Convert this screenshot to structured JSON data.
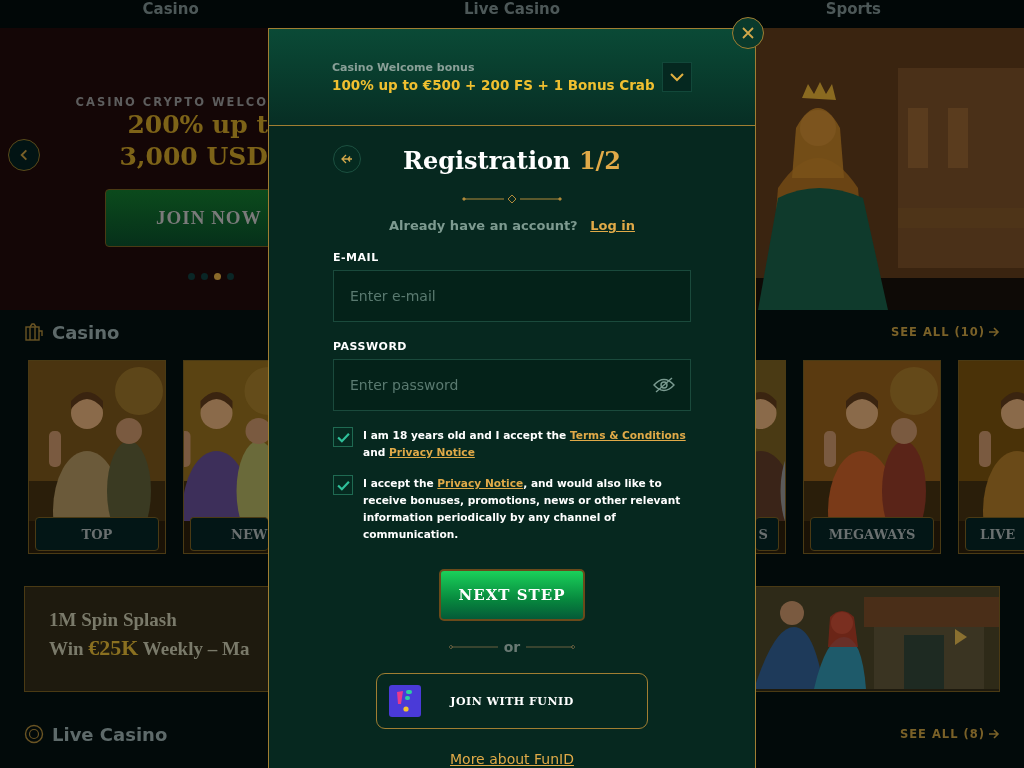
{
  "nav": {
    "tabs": [
      {
        "label": "Casino"
      },
      {
        "label": "Live Casino"
      },
      {
        "label": "Sports"
      }
    ]
  },
  "hero": {
    "eyebrow": "CASINO CRYPTO WELCO",
    "headline": [
      "200% up t",
      "3,000 USD"
    ],
    "button": "JOIN NOW",
    "dots": [
      {
        "selected": false
      },
      {
        "selected": false
      },
      {
        "selected": true
      },
      {
        "selected": false
      }
    ]
  },
  "casino_section": {
    "title": "Casino",
    "see_all": "SEE ALL (10)",
    "cards_left": [
      {
        "label": "TOP"
      },
      {
        "label": "NEW"
      }
    ],
    "cards_right": [
      {
        "label": "S"
      },
      {
        "label": "MEGAWAYS"
      },
      {
        "label": "LIVE"
      }
    ]
  },
  "promo": {
    "title": "1M Spin Splash",
    "before": "Win",
    "highlight": "€25K",
    "after": "Weekly – Ma"
  },
  "live_section": {
    "title": "Live Casino",
    "see_all": "SEE ALL (8)"
  },
  "modal": {
    "bonus_label": "Casino Welcome bonus",
    "bonus_offer": "100% up to €500 + 200 FS + 1 Bonus Crab",
    "title": "Registration",
    "step": "1/2",
    "login_prompt": "Already have an account?",
    "login_link": "Log in",
    "fields": [
      {
        "kind": "email",
        "label": "E-MAIL",
        "placeholder": "Enter e-mail"
      },
      {
        "kind": "password",
        "label": "PASSWORD",
        "placeholder": "Enter password"
      }
    ],
    "consents": [
      {
        "checked": true,
        "parts": [
          {
            "kind": "text",
            "text": "I am 18 years old and I accept the "
          },
          {
            "kind": "link",
            "text": "Terms & Conditions"
          },
          {
            "kind": "text",
            "text": " and "
          },
          {
            "kind": "link",
            "text": "Privacy Notice"
          }
        ]
      },
      {
        "checked": true,
        "parts": [
          {
            "kind": "text",
            "text": "I accept the "
          },
          {
            "kind": "link",
            "text": "Privacy Notice"
          },
          {
            "kind": "text",
            "text": ", and would also like to receive bonuses, promotions, news or other relevant information periodically by any channel of communication."
          }
        ]
      }
    ],
    "next_button": "NEXT STEP",
    "or": "or",
    "funid_button": "JOIN WITH FUNID",
    "funid_link": "More about FunID"
  }
}
